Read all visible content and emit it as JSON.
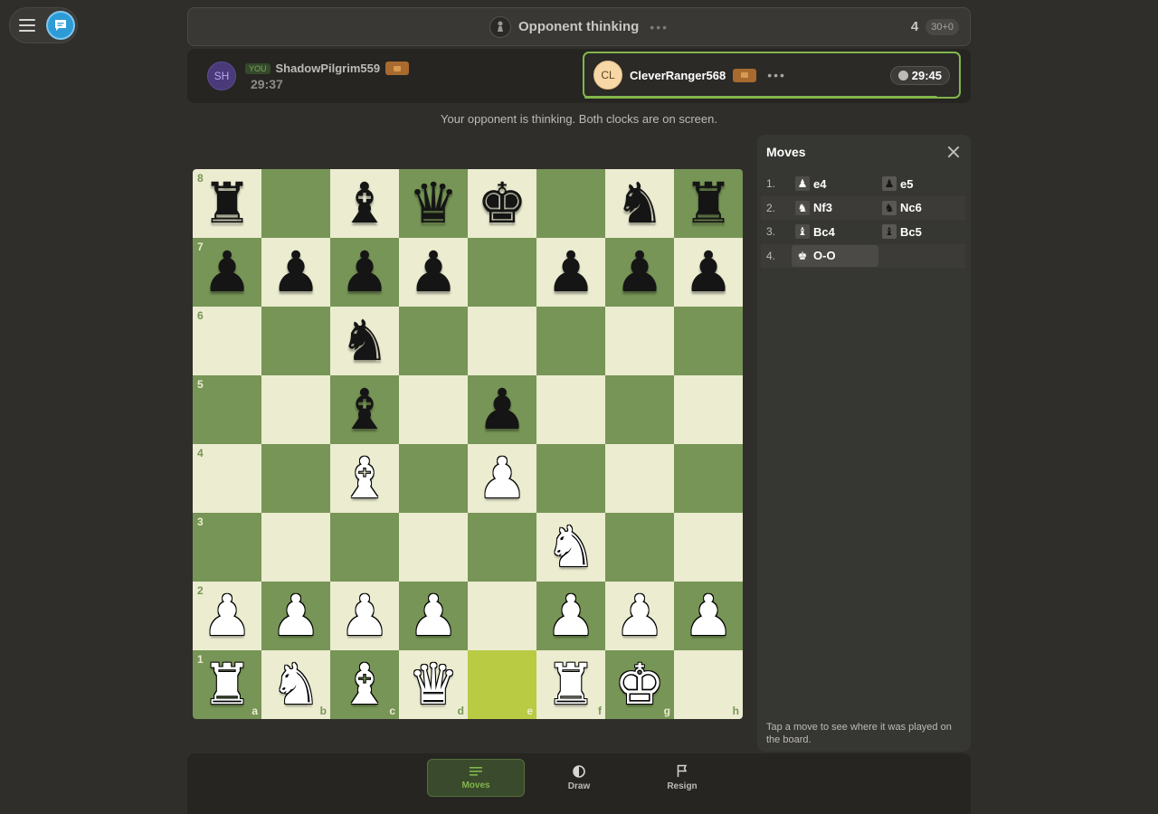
{
  "status": {
    "text": "Opponent thinking",
    "dots": "•••",
    "move_number": "4",
    "time_control": "30+0"
  },
  "players": {
    "you": {
      "initials": "SH",
      "tag": "YOU",
      "name": "ShadowPilgrim559",
      "clock": "29:37"
    },
    "opponent": {
      "initials": "CL",
      "name": "CleverRanger568",
      "dots": "•••",
      "clock": "29:45"
    }
  },
  "subtitle": "Your opponent is thinking. Both clocks are on screen.",
  "board": {
    "ranks": [
      "8",
      "7",
      "6",
      "5",
      "4",
      "3",
      "2",
      "1"
    ],
    "files": [
      "a",
      "b",
      "c",
      "d",
      "e",
      "f",
      "g",
      "h"
    ],
    "position": [
      [
        "br",
        "",
        "bb",
        "bq",
        "bk",
        "",
        "bn",
        "br"
      ],
      [
        "bp",
        "bp",
        "bp",
        "bp",
        "",
        "bp",
        "bp",
        "bp"
      ],
      [
        "",
        "",
        "bn",
        "",
        "",
        "",
        "",
        ""
      ],
      [
        "",
        "",
        "bb",
        "",
        "bp",
        "",
        "",
        ""
      ],
      [
        "",
        "",
        "wb",
        "",
        "wp",
        "",
        "",
        ""
      ],
      [
        "",
        "",
        "",
        "",
        "",
        "wn",
        "",
        ""
      ],
      [
        "wp",
        "wp",
        "wp",
        "wp",
        "",
        "wp",
        "wp",
        "wp"
      ],
      [
        "wr",
        "wn",
        "wb",
        "wq",
        "",
        "wr",
        "wk",
        ""
      ]
    ],
    "highlight": [
      "1-e"
    ]
  },
  "moves_panel": {
    "title": "Moves",
    "moves": [
      {
        "num": "1.",
        "white": "e4",
        "white_icon": "pawn-icon",
        "black": "e5",
        "black_icon": "pawn-icon"
      },
      {
        "num": "2.",
        "white": "Nf3",
        "white_icon": "knight-icon",
        "black": "Nc6",
        "black_icon": "knight-icon"
      },
      {
        "num": "3.",
        "white": "Bc4",
        "white_icon": "bishop-icon",
        "black": "Bc5",
        "black_icon": "bishop-icon"
      },
      {
        "num": "4.",
        "white": "O-O",
        "white_icon": "king-icon",
        "black": "",
        "black_icon": ""
      }
    ],
    "footer": "Tap a move to see where it was played on the board."
  },
  "nav": {
    "moves": "Moves",
    "draw": "Draw",
    "resign": "Resign"
  },
  "colors": {
    "accent": "#81b64c",
    "light_square": "#ebecd0",
    "dark_square": "#779556",
    "highlight": "#b9ca43",
    "chat_blue": "#2d9bd6"
  }
}
